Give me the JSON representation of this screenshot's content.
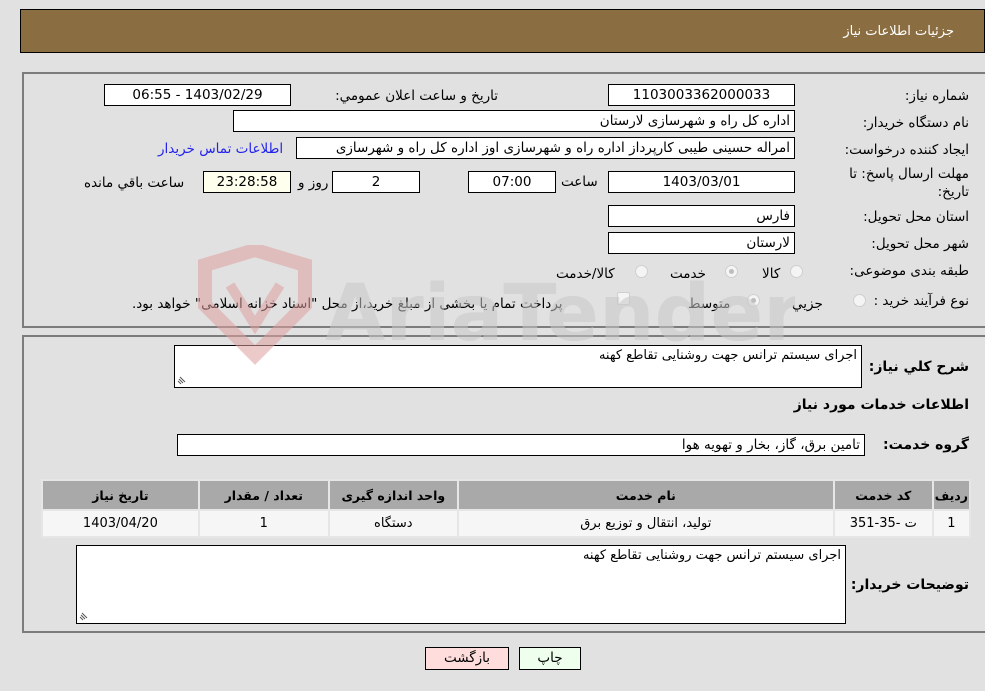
{
  "header": {
    "title": "جزئیات اطلاعات نیاز"
  },
  "details": {
    "need_number_label": "شماره نیاز:",
    "need_number": "1103003362000033",
    "announce_label": "تاریخ و ساعت اعلان عمومي:",
    "announce_value": "1403/02/29 - 06:55",
    "buyer_org_label": "نام دستگاه خریدار:",
    "buyer_org": "اداره کل راه و شهرسازی لارستان",
    "requester_label": "ایجاد کننده درخواست:",
    "requester": "امراله حسینی طیبی کارپرداز اداره راه و شهرسازی اوز اداره کل راه و شهرسازی",
    "contact_link": "اطلاعات تماس خریدار",
    "deadline_label": "مهلت ارسال پاسخ: تا تاریخ:",
    "deadline_date": "1403/03/01",
    "time_label": "ساعت",
    "deadline_time": "07:00",
    "days_value": "2",
    "days_label": "روز و",
    "remaining_time": "23:28:58",
    "remaining_label": "ساعت باقي مانده",
    "province_label": "استان محل تحویل:",
    "province": "فارس",
    "city_label": "شهر محل تحویل:",
    "city": "لارستان",
    "category_label": "طبقه بندی موضوعی:",
    "category_options": [
      {
        "label": "کالا",
        "selected": false
      },
      {
        "label": "خدمت",
        "selected": true
      },
      {
        "label": "کالا/خدمت",
        "selected": false
      }
    ],
    "process_label": "نوع فرآیند خرید :",
    "process_options": [
      {
        "label": "جزيي",
        "selected": false
      },
      {
        "label": "متوسط",
        "selected": true
      }
    ],
    "treasury_note": "پرداخت تمام یا بخشی از مبلغ خرید،از محل \"اسناد خزانه اسلامی\" خواهد بود.",
    "treasury_checked": false
  },
  "services": {
    "summary_label": "شرح كلي نياز:",
    "summary": "اجرای سیستم ترانس جهت روشنایی تقاطع کهنه",
    "section_title": "اطلاعات خدمات مورد نیاز",
    "group_label": "گروه خدمت:",
    "group": "تامین برق، گاز، بخار و تهویه هوا",
    "table": {
      "headers": [
        "ردیف",
        "کد خدمت",
        "نام خدمت",
        "واحد اندازه گیری",
        "تعداد / مقدار",
        "تاریخ نیاز"
      ],
      "rows": [
        [
          "1",
          "ت -35-351",
          "تولید، انتقال و توزیع برق",
          "دستگاه",
          "1",
          "1403/04/20"
        ]
      ]
    },
    "buyer_notes_label": "توضیحات خریدار:",
    "buyer_notes": "اجرای سیستم ترانس جهت روشنایی تقاطع کهنه"
  },
  "buttons": {
    "print": "چاپ",
    "back": "بازگشت"
  },
  "colors": {
    "header_bg": "#8b6d42",
    "print_bg": "#eeffee",
    "back_bg": "#ffdddd",
    "link": "#2222ee"
  }
}
